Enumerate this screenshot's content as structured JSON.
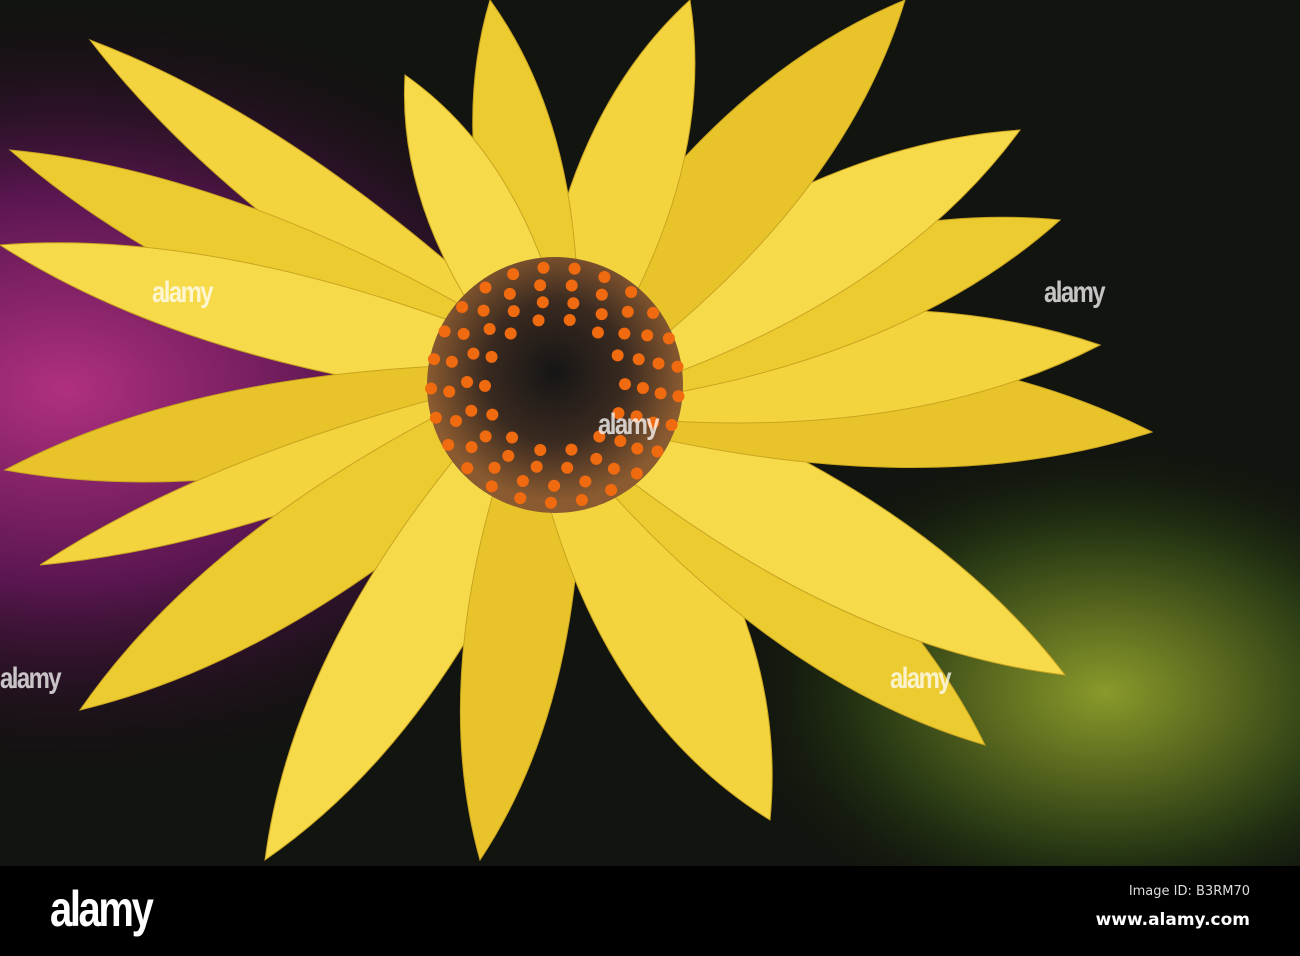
{
  "footer": {
    "logo": "alamy",
    "image_id": "Image ID: B3RM70",
    "website": "www.alamy.com"
  },
  "watermark": {
    "text": "alamy"
  },
  "colors": {
    "petal": "#f2d23c",
    "ring": "#5a2a9a",
    "pollen": "#f06a10",
    "background_left": "#6a1a5a",
    "background_right": "#0e1a0c"
  }
}
